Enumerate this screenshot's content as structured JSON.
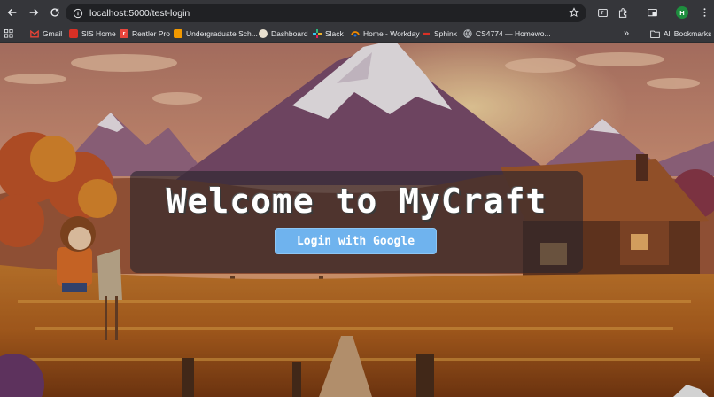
{
  "browser": {
    "url": "localhost:5000/test-login",
    "profile_initial": "H"
  },
  "bookmarks": [
    {
      "label": "Gmail",
      "icon": "gmail-icon",
      "color": "#ea4335"
    },
    {
      "label": "SIS Home",
      "icon": "sis-icon",
      "color": "#d93025"
    },
    {
      "label": "Rentler Pro",
      "icon": "rentler-icon",
      "color": "#e8453c"
    },
    {
      "label": "Undergraduate Sch...",
      "icon": "school-icon",
      "color": "#f29900"
    },
    {
      "label": "Dashboard",
      "icon": "dashboard-icon",
      "color": "#bdc1c6"
    },
    {
      "label": "Slack",
      "icon": "slack-icon",
      "color": "#36c5f0"
    },
    {
      "label": "Home - Workday",
      "icon": "workday-icon",
      "color": "#1a73e8"
    },
    {
      "label": "Sphinx",
      "icon": "sphinx-icon",
      "color": "#d93025"
    },
    {
      "label": "CS4774 — Homewo...",
      "icon": "globe-icon",
      "color": "#bdc1c6"
    }
  ],
  "all_bookmarks_label": "All Bookmarks",
  "page": {
    "title": "Welcome to MyCraft",
    "login_button": "Login with Google"
  },
  "colors": {
    "button": "#6fb3ee",
    "panel": "rgba(40,36,44,0.62)",
    "chrome": "#35363a"
  }
}
